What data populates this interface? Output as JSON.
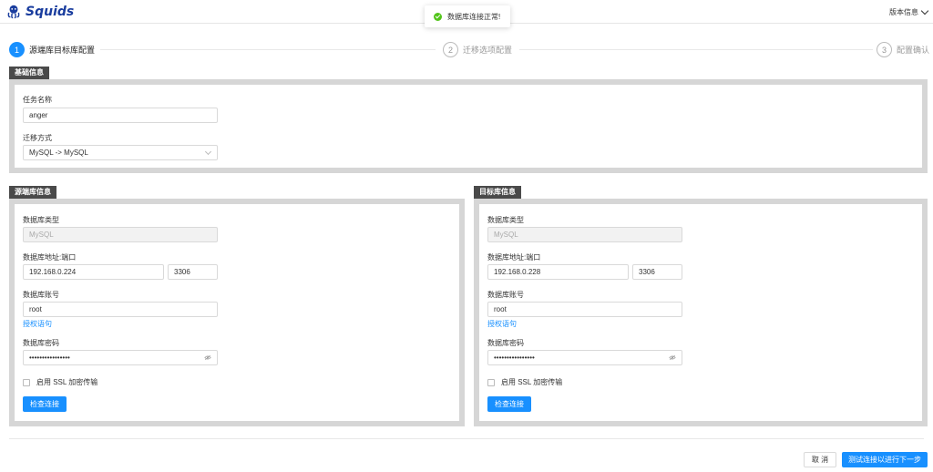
{
  "header": {
    "logo_text": "Squids",
    "version_label": "版本信息"
  },
  "toast": {
    "message": "数据库连接正常!",
    "status_color": "#52c41a"
  },
  "steps": [
    {
      "num": "1",
      "label": "源端库目标库配置",
      "state": "active"
    },
    {
      "num": "2",
      "label": "迁移选项配置",
      "state": "inactive"
    },
    {
      "num": "3",
      "label": "配置确认",
      "state": "inactive"
    }
  ],
  "basic": {
    "tag": "基础信息",
    "task_name_label": "任务名称",
    "task_name_value": "anger",
    "method_label": "迁移方式",
    "method_value": "MySQL -> MySQL"
  },
  "source": {
    "tag": "源端库信息",
    "db_type_label": "数据库类型",
    "db_type_value": "MySQL",
    "address_label": "数据库地址:端口",
    "host_value": "192.168.0.224",
    "port_value": "3306",
    "account_label": "数据库账号",
    "account_value": "root",
    "grant_link": "授权语句",
    "password_label": "数据库密码",
    "password_value": "••••••••••••••••",
    "ssl_label": "启用 SSL 加密传输",
    "ssl_checked": false,
    "check_button": "检查连接"
  },
  "target": {
    "tag": "目标库信息",
    "db_type_label": "数据库类型",
    "db_type_value": "MySQL",
    "address_label": "数据库地址:端口",
    "host_value": "192.168.0.228",
    "port_value": "3306",
    "account_label": "数据库账号",
    "account_value": "root",
    "grant_link": "授权语句",
    "password_label": "数据库密码",
    "password_value": "••••••••••••••••",
    "ssl_label": "启用 SSL 加密传输",
    "ssl_checked": false,
    "check_button": "检查连接"
  },
  "footer": {
    "cancel_button": "取 消",
    "next_button": "测试连接以进行下一步"
  },
  "colors": {
    "primary": "#1890ff",
    "brand": "#1a3d9e",
    "panel_border": "#d6d6d6",
    "tag_bg": "#4a4a4a"
  }
}
